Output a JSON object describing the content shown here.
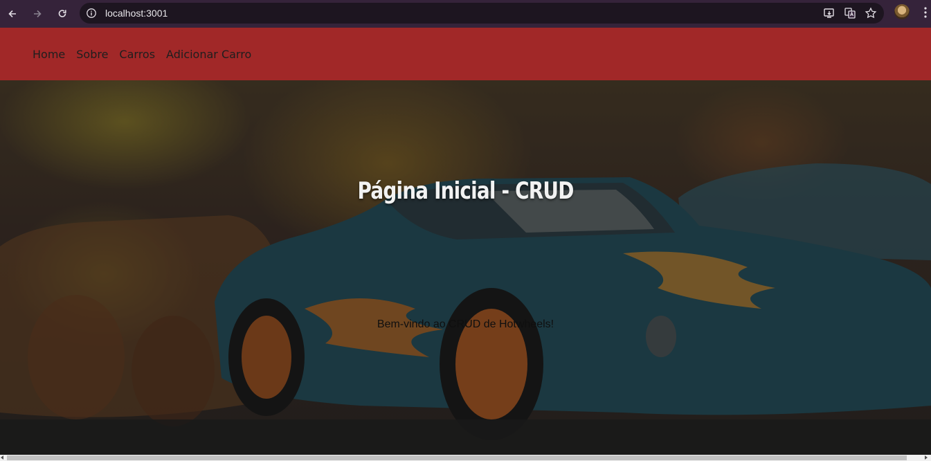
{
  "browser": {
    "url": "localhost:3001",
    "icons": [
      "back-arrow-icon",
      "forward-arrow-icon",
      "reload-icon",
      "site-info-icon",
      "install-app-icon",
      "translate-icon",
      "bookmark-star-icon",
      "profile-avatar",
      "menu-kebab-icon"
    ]
  },
  "nav": {
    "items": [
      {
        "label": "Home"
      },
      {
        "label": "Sobre"
      },
      {
        "label": "Carros"
      },
      {
        "label": "Adicionar Carro"
      }
    ]
  },
  "hero": {
    "title": "Página Inicial - CRUD",
    "subtitle": "Bem-vindo ao CRUD de Hotwheels!"
  },
  "colors": {
    "chrome_bg": "#35233a",
    "navbar_bg": "#a12828",
    "hero_title": "#f2f2f2"
  }
}
